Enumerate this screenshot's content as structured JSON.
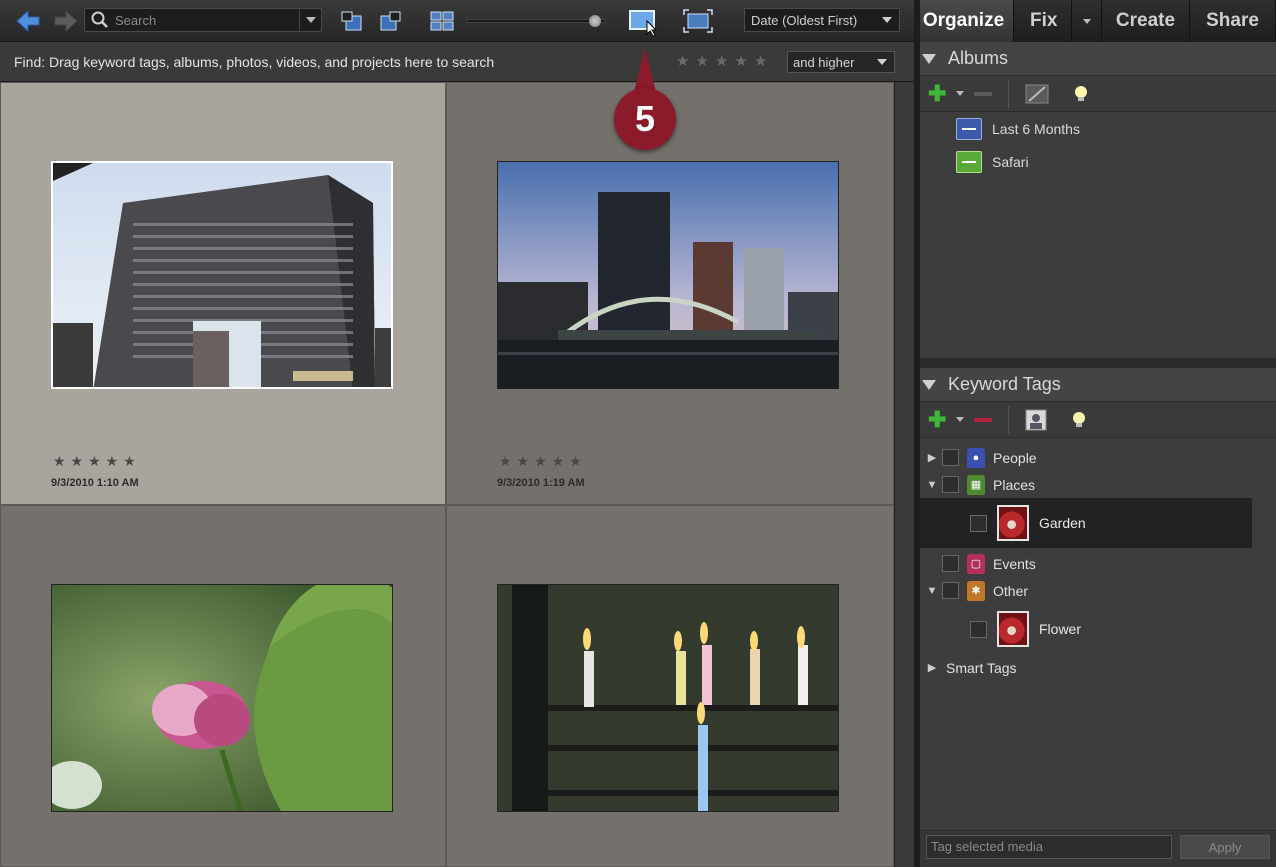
{
  "toolbar": {
    "search_placeholder": "Search",
    "sort_selected": "Date (Oldest First)"
  },
  "tabs": [
    {
      "label": "Organize",
      "active": true
    },
    {
      "label": "Fix",
      "active": false
    },
    {
      "label": "Create",
      "active": false
    },
    {
      "label": "Share",
      "active": false
    }
  ],
  "findbar": {
    "text": "Find: Drag keyword tags, albums, photos, videos, and projects here to search",
    "rating_filter": "and higher"
  },
  "photos": [
    {
      "date": "9/3/2010 1:10 AM",
      "stars": "★★★★★",
      "subject": "office building",
      "selected": true
    },
    {
      "date": "9/3/2010 1:19 AM",
      "stars": "★★★★★",
      "subject": "bridge at dusk",
      "selected": false
    },
    {
      "date": "",
      "stars": "",
      "subject": "lotus flower",
      "selected": false
    },
    {
      "date": "",
      "stars": "",
      "subject": "candles",
      "selected": false
    }
  ],
  "callout": {
    "number": "5"
  },
  "albums": {
    "title": "Albums",
    "items": [
      {
        "label": "Last 6 Months",
        "color": "#3c5aa8"
      },
      {
        "label": "Safari",
        "color": "#5aa83a"
      }
    ]
  },
  "keywords": {
    "title": "Keyword Tags",
    "items": [
      {
        "label": "People",
        "color": "#3b4fb0"
      },
      {
        "label": "Places",
        "color": "#4e8a32"
      },
      {
        "label": "Garden"
      },
      {
        "label": "Events",
        "color": "#b2305a"
      },
      {
        "label": "Other",
        "color": "#c07828"
      },
      {
        "label": "Flower"
      },
      {
        "label": "Smart Tags"
      }
    ]
  },
  "footer": {
    "tag_placeholder": "Tag selected media",
    "apply_label": "Apply"
  },
  "colors": {
    "accent": "#8b1a2b",
    "add_green": "#3fb53a",
    "remove_red": "#b2243e"
  }
}
